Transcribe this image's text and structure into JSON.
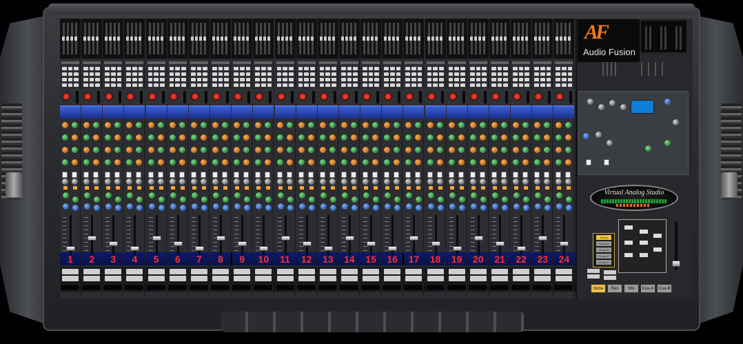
{
  "brand": {
    "logo_text": "AF",
    "name": "Audio Fusion"
  },
  "studio_badge": "Virtual Analog Studio",
  "channels": [
    "1",
    "2",
    "3",
    "4",
    "5",
    "6",
    "7",
    "8",
    "9",
    "10",
    "11",
    "12",
    "13",
    "14",
    "15",
    "16",
    "17",
    "18",
    "19",
    "20",
    "21",
    "22",
    "23",
    "24"
  ],
  "monitor": {
    "panel_buttons": [
      "Group",
      "Group-A",
      "Group-B",
      "Group-C",
      "Group-D"
    ],
    "source_buttons": [
      "None",
      "Rec",
      "Mix",
      "Cue-A",
      "Cue-B"
    ],
    "active_source": "None"
  },
  "colors": {
    "accent": "#f0c14a",
    "channel_number": "#ff3030",
    "brand_red": "#e33a1c"
  }
}
